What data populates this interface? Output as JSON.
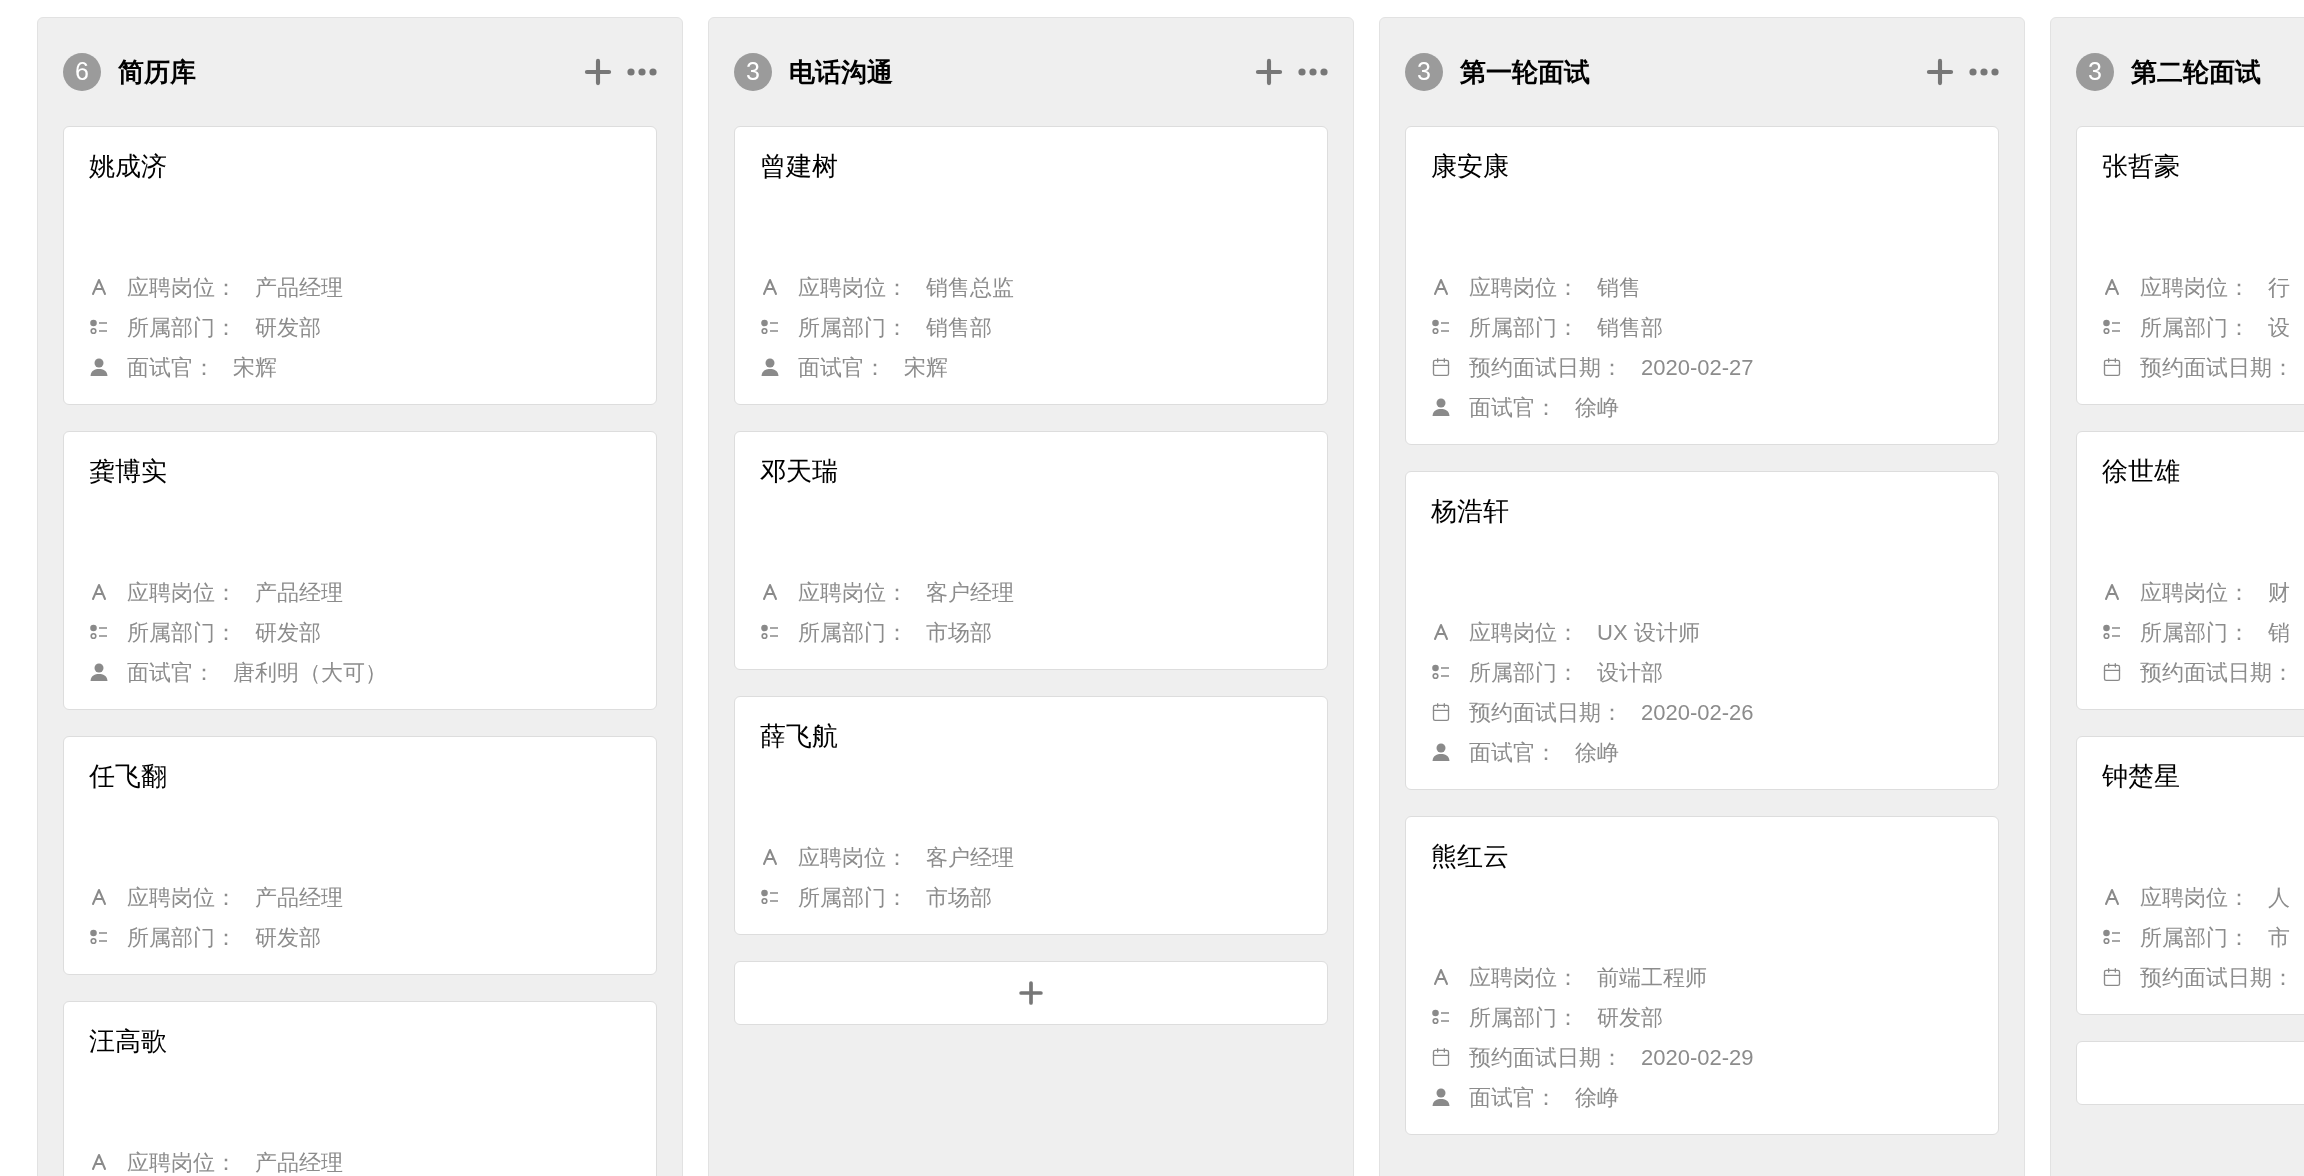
{
  "columns": [
    {
      "title": "简历库",
      "count": "6",
      "cards": [
        {
          "name": "姚成济",
          "fields": [
            {
              "kind": "text",
              "label": "应聘岗位：",
              "value": "产品经理"
            },
            {
              "kind": "select",
              "label": "所属部门：",
              "value": "研发部"
            },
            {
              "kind": "person",
              "label": "面试官：",
              "value": "宋辉"
            }
          ]
        },
        {
          "name": "龚博实",
          "fields": [
            {
              "kind": "text",
              "label": "应聘岗位：",
              "value": "产品经理"
            },
            {
              "kind": "select",
              "label": "所属部门：",
              "value": "研发部"
            },
            {
              "kind": "person",
              "label": "面试官：",
              "value": "唐利明（大可）"
            }
          ]
        },
        {
          "name": "任飞翻",
          "fields": [
            {
              "kind": "text",
              "label": "应聘岗位：",
              "value": "产品经理"
            },
            {
              "kind": "select",
              "label": "所属部门：",
              "value": "研发部"
            }
          ]
        },
        {
          "name": "汪高歌",
          "fields": [
            {
              "kind": "text",
              "label": "应聘岗位：",
              "value": "产品经理"
            }
          ]
        }
      ]
    },
    {
      "title": "电话沟通",
      "count": "3",
      "add_card_button": true,
      "cards": [
        {
          "name": "曾建树",
          "fields": [
            {
              "kind": "text",
              "label": "应聘岗位：",
              "value": "销售总监"
            },
            {
              "kind": "select",
              "label": "所属部门：",
              "value": "销售部"
            },
            {
              "kind": "person",
              "label": "面试官：",
              "value": "宋辉"
            }
          ]
        },
        {
          "name": "邓天瑞",
          "fields": [
            {
              "kind": "text",
              "label": "应聘岗位：",
              "value": "客户经理"
            },
            {
              "kind": "select",
              "label": "所属部门：",
              "value": "市场部"
            }
          ]
        },
        {
          "name": "薛飞航",
          "fields": [
            {
              "kind": "text",
              "label": "应聘岗位：",
              "value": "客户经理"
            },
            {
              "kind": "select",
              "label": "所属部门：",
              "value": "市场部"
            }
          ]
        }
      ]
    },
    {
      "title": "第一轮面试",
      "count": "3",
      "cards": [
        {
          "name": "康安康",
          "fields": [
            {
              "kind": "text",
              "label": "应聘岗位：",
              "value": "销售"
            },
            {
              "kind": "select",
              "label": "所属部门：",
              "value": "销售部"
            },
            {
              "kind": "date",
              "label": "预约面试日期：",
              "value": "2020-02-27"
            },
            {
              "kind": "person",
              "label": "面试官：",
              "value": "徐峥"
            }
          ]
        },
        {
          "name": "杨浩轩",
          "fields": [
            {
              "kind": "text",
              "label": "应聘岗位：",
              "value": "UX 设计师"
            },
            {
              "kind": "select",
              "label": "所属部门：",
              "value": "设计部"
            },
            {
              "kind": "date",
              "label": "预约面试日期：",
              "value": "2020-02-26"
            },
            {
              "kind": "person",
              "label": "面试官：",
              "value": "徐峥"
            }
          ]
        },
        {
          "name": "熊红云",
          "fields": [
            {
              "kind": "text",
              "label": "应聘岗位：",
              "value": "前端工程师"
            },
            {
              "kind": "select",
              "label": "所属部门：",
              "value": "研发部"
            },
            {
              "kind": "date",
              "label": "预约面试日期：",
              "value": "2020-02-29"
            },
            {
              "kind": "person",
              "label": "面试官：",
              "value": "徐峥"
            }
          ]
        }
      ]
    },
    {
      "title": "第二轮面试",
      "count": "3",
      "add_card_button": true,
      "cards": [
        {
          "name": "张哲豪",
          "fields": [
            {
              "kind": "text",
              "label": "应聘岗位：",
              "value": "行"
            },
            {
              "kind": "select",
              "label": "所属部门：",
              "value": "设"
            },
            {
              "kind": "date",
              "label": "预约面试日期："
            }
          ]
        },
        {
          "name": "徐世雄",
          "fields": [
            {
              "kind": "text",
              "label": "应聘岗位：",
              "value": "财"
            },
            {
              "kind": "select",
              "label": "所属部门：",
              "value": "销"
            },
            {
              "kind": "date",
              "label": "预约面试日期："
            }
          ]
        },
        {
          "name": "钟楚星",
          "fields": [
            {
              "kind": "text",
              "label": "应聘岗位：",
              "value": "人"
            },
            {
              "kind": "select",
              "label": "所属部门：",
              "value": "市"
            },
            {
              "kind": "date",
              "label": "预约面试日期："
            }
          ]
        }
      ]
    }
  ]
}
